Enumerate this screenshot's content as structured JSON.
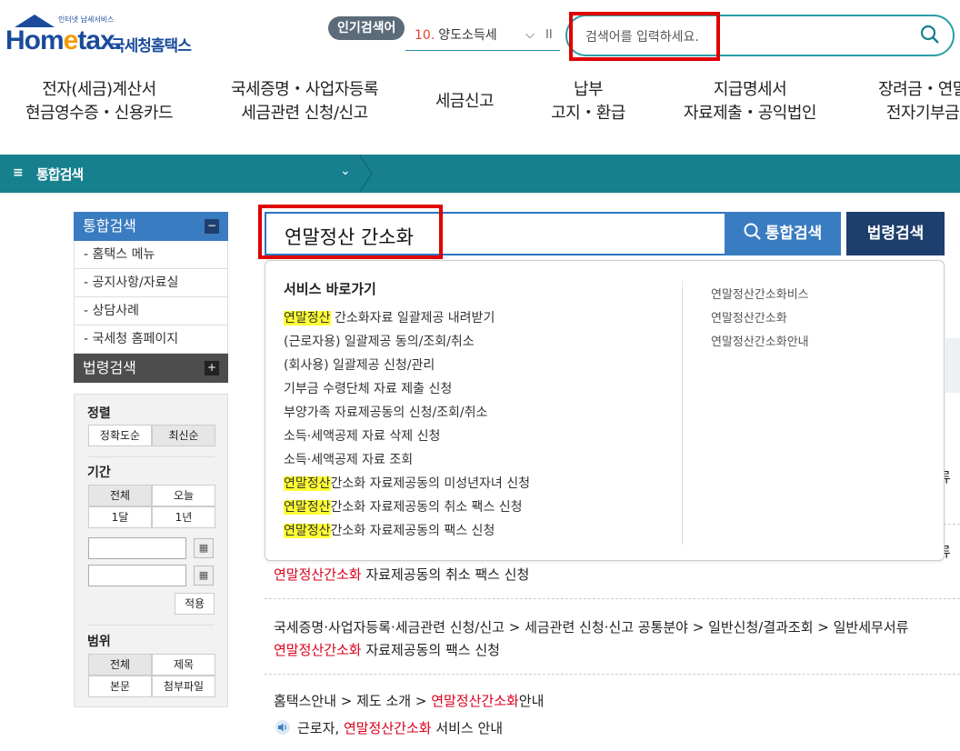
{
  "header": {
    "logo_small": "인터넷 납세서비스",
    "logo_text_a": "Hom",
    "logo_text_e": "e",
    "logo_text_b": "tax.",
    "logo_kr": "국세청홈택스",
    "popular_label": "인기검색어",
    "popular_rank": "10.",
    "popular_term": "양도소득세",
    "search_placeholder": "검색어를 입력하세요."
  },
  "gnb": [
    {
      "line1": "전자(세금)계산서",
      "line2": "현금영수증・신용카드"
    },
    {
      "line1": "국세증명・사업자등록",
      "line2": "세금관련 신청/신고"
    },
    {
      "line1": "세금신고",
      "line2": ""
    },
    {
      "line1": "납부",
      "line2": "고지・환급"
    },
    {
      "line1": "지급명세서",
      "line2": "자료제출・공익법인"
    },
    {
      "line1": "장려금・연말",
      "line2": "전자기부금"
    }
  ],
  "subbar": {
    "menu_icon": "≡",
    "label": "통합검색"
  },
  "sidebar": {
    "head1": "통합검색",
    "items": [
      "- 홈택스 메뉴",
      "- 공지사항/자료실",
      "- 상담사례",
      "- 국세청 홈페이지"
    ],
    "head2": "법령검색"
  },
  "filter": {
    "sort_title": "정렬",
    "sort_options": [
      "정확도순",
      "최신순"
    ],
    "period_title": "기간",
    "period_options": [
      "전체",
      "오늘",
      "1달",
      "1년"
    ],
    "apply": "적용",
    "scope_title": "범위",
    "scope_options": [
      "전체",
      "제목",
      "본문",
      "첨부파일"
    ]
  },
  "search": {
    "value": "연말정산 간소화",
    "integrated_button": "통합검색",
    "law_button": "법령검색"
  },
  "popup": {
    "title": "서비스 바로가기",
    "items": [
      {
        "hl": "연말정산",
        "rest": " 간소화자료 일괄제공 내려받기"
      },
      {
        "hl": "",
        "rest": "(근로자용) 일괄제공 동의/조회/취소"
      },
      {
        "hl": "",
        "rest": "(회사용) 일괄제공 신청/관리"
      },
      {
        "hl": "",
        "rest": "기부금 수령단체 자료 제출 신청"
      },
      {
        "hl": "",
        "rest": "부양가족 자료제공동의 신청/조회/취소"
      },
      {
        "hl": "",
        "rest": "소득·세액공제 자료 삭제 신청"
      },
      {
        "hl": "",
        "rest": "소득·세액공제 자료 조회"
      },
      {
        "hl": "연말정산",
        "rest": "간소화 자료제공동의 미성년자녀 신청"
      },
      {
        "hl": "연말정산",
        "rest": "간소화 자료제공동의 취소 팩스 신청"
      },
      {
        "hl": "연말정산",
        "rest": "간소화 자료제공동의 팩스 신청"
      }
    ],
    "suggestions": [
      "연말정산간소화비스",
      "연말정산간소화",
      "연말정산간소화안내"
    ]
  },
  "results": {
    "r1_suffix": "류",
    "r2_suffix": "류",
    "r3_red": "연말정산간소화",
    "r3_rest": " 자료제공동의 취소 팩스 신청",
    "r4_path": "국세증명·사업자등록·세금관련 신청/신고 > 세금관련 신청·신고 공통분야 > 일반신청/결과조회 > 일반세무서류",
    "r4_red": "연말정산간소화",
    "r4_rest": " 자료제공동의 팩스 신청",
    "r5_path_a": "홈택스안내 > 제도 소개 > ",
    "r5_path_red": "연말정산간소화",
    "r5_path_b": "안내",
    "r5_sub_a": "근로자, ",
    "r5_sub_red": "연말정산간소화",
    "r5_sub_b": " 서비스 안내"
  },
  "colors": {
    "teal": "#17808e",
    "blue": "#3a7cc1",
    "navy": "#1e3f6e",
    "highlight": "#ffff33",
    "red": "#d9001b"
  }
}
